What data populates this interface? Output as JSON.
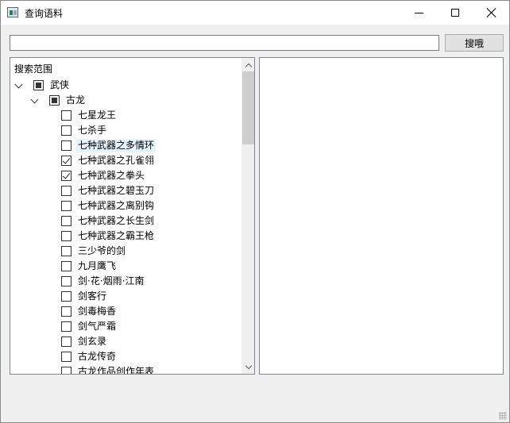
{
  "window": {
    "title": "查询语料",
    "app_icon": "app-window-icon",
    "controls": [
      "minimize-icon",
      "maximize-icon",
      "close-icon"
    ]
  },
  "search": {
    "value": "",
    "placeholder": "",
    "button_label": "搜哦"
  },
  "tree": {
    "header": "搜索范围",
    "root": {
      "label": "武侠",
      "state": "partial",
      "expanded": true
    },
    "group": {
      "label": "古龙",
      "state": "partial",
      "expanded": true
    },
    "items": [
      {
        "label": "七星龙王",
        "checked": false
      },
      {
        "label": "七杀手",
        "checked": false
      },
      {
        "label": "七种武器之多情环",
        "checked": false,
        "hover": true
      },
      {
        "label": "七种武器之孔雀翎",
        "checked": true
      },
      {
        "label": "七种武器之拳头",
        "checked": true
      },
      {
        "label": "七种武器之碧玉刀",
        "checked": false
      },
      {
        "label": "七种武器之离别钩",
        "checked": false
      },
      {
        "label": "七种武器之长生剑",
        "checked": false
      },
      {
        "label": "七种武器之霸王枪",
        "checked": false
      },
      {
        "label": "三少爷的剑",
        "checked": false
      },
      {
        "label": "九月鹰飞",
        "checked": false
      },
      {
        "label": "剑·花·烟雨·江南",
        "checked": false
      },
      {
        "label": "剑客行",
        "checked": false
      },
      {
        "label": "剑毒梅香",
        "checked": false
      },
      {
        "label": "剑气严霜",
        "checked": false
      },
      {
        "label": "剑玄录",
        "checked": false
      },
      {
        "label": "古龙传奇",
        "checked": false
      },
      {
        "label": "古龙作品创作年表",
        "checked": false
      }
    ]
  },
  "results": {
    "text": ""
  }
}
